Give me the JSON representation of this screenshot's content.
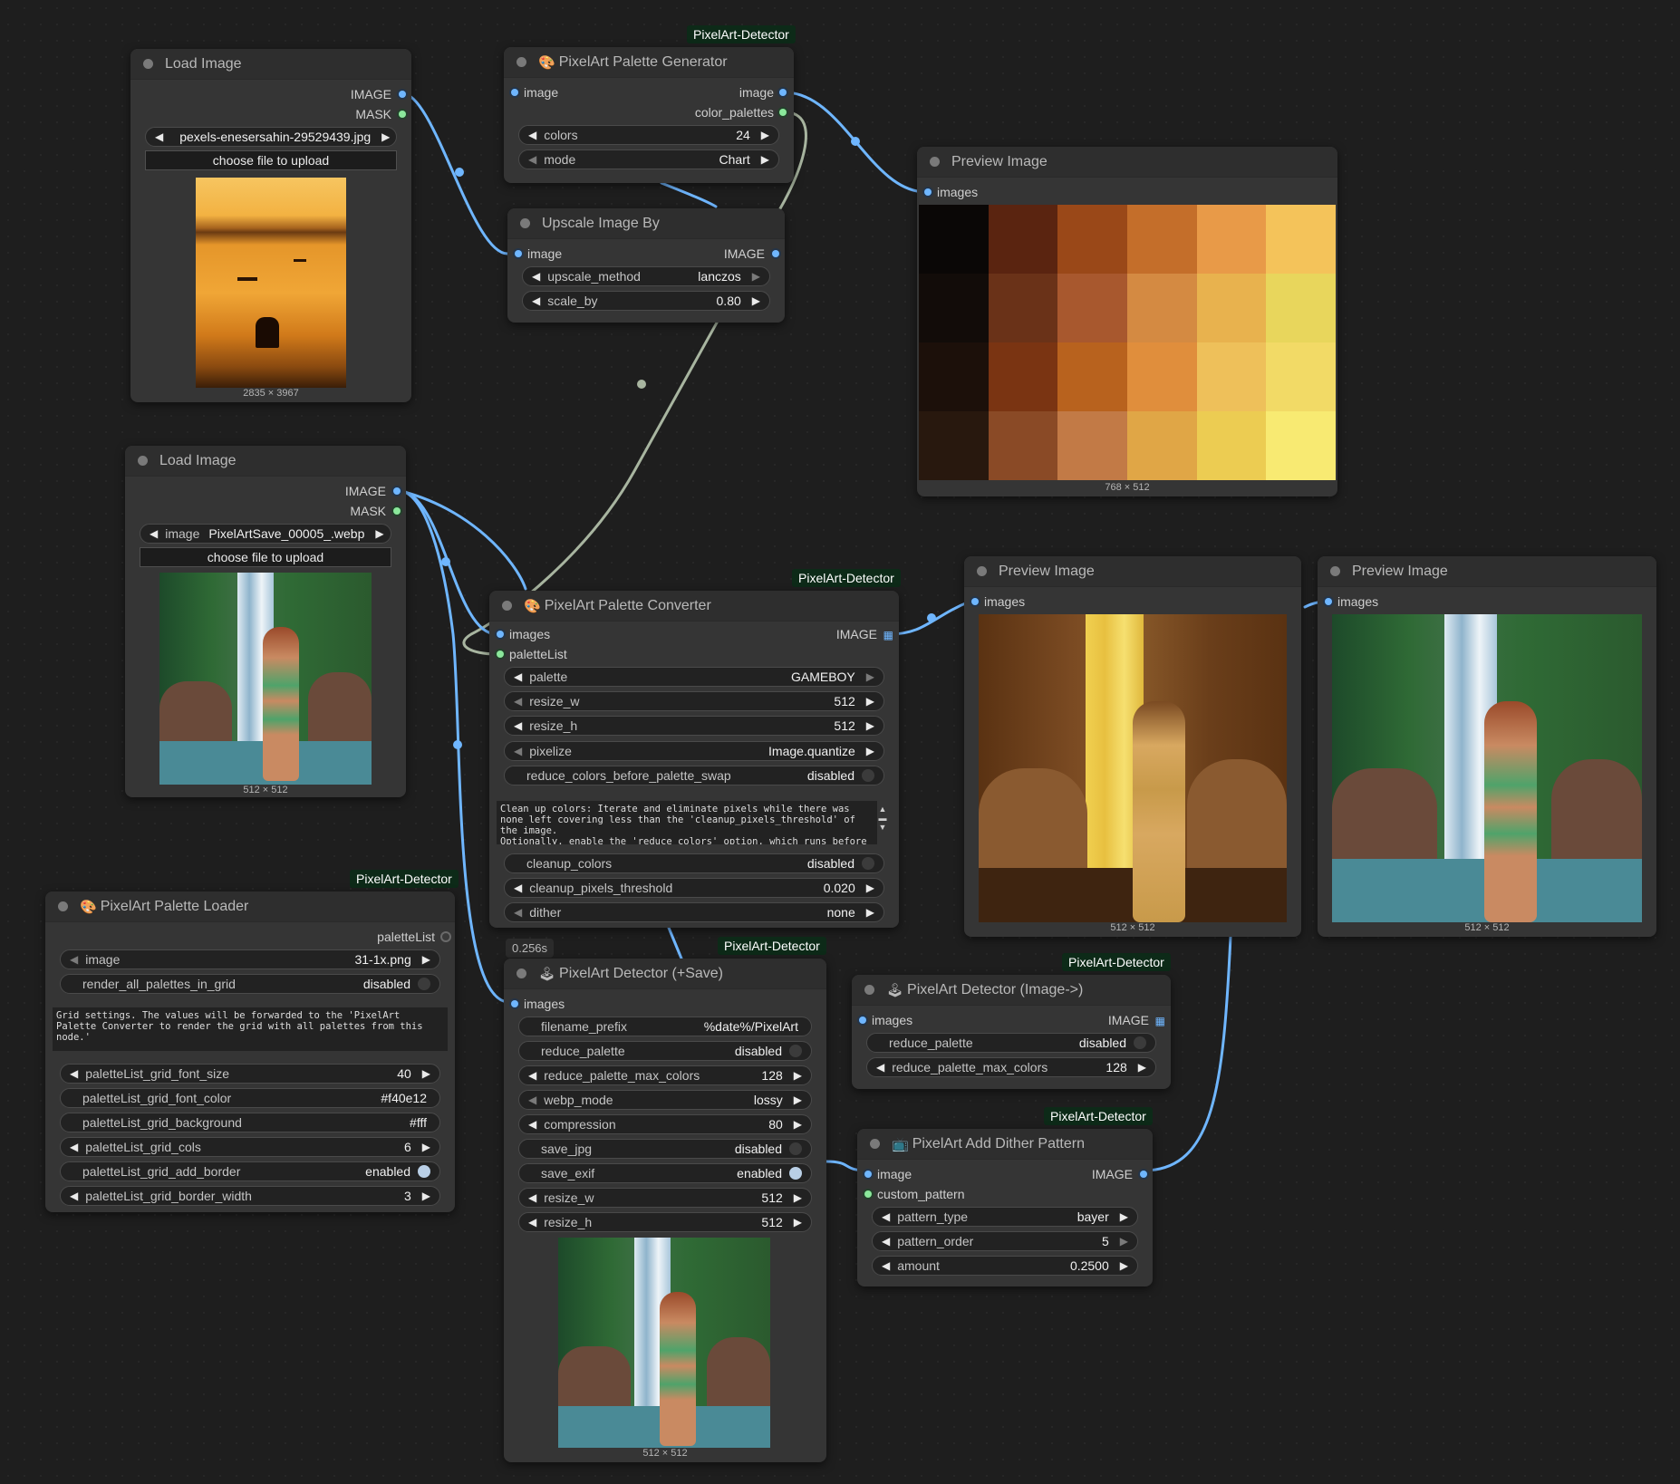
{
  "badge_label": "PixelArt-Detector",
  "nodes": {
    "load_image_1": {
      "title": "Load Image",
      "outputs": [
        "IMAGE",
        "MASK"
      ],
      "image_widget": {
        "label": "",
        "value": "pexels-enesersahin-29529439.jpg"
      },
      "upload_label": "choose file to upload",
      "dims": "2835 × 3967"
    },
    "palette_generator": {
      "title": "PixelArt Palette Generator",
      "input": "image",
      "outputs": [
        "image",
        "color_palettes"
      ],
      "widgets": [
        {
          "label": "colors",
          "value": "24"
        },
        {
          "label": "mode",
          "value": "Chart"
        }
      ]
    },
    "upscale": {
      "title": "Upscale Image By",
      "input": "image",
      "output": "IMAGE",
      "widgets": [
        {
          "label": "upscale_method",
          "value": "lanczos"
        },
        {
          "label": "scale_by",
          "value": "0.80"
        }
      ]
    },
    "preview_1": {
      "title": "Preview Image",
      "input": "images",
      "dims": "768 × 512"
    },
    "load_image_2": {
      "title": "Load Image",
      "outputs": [
        "IMAGE",
        "MASK"
      ],
      "image_widget": {
        "label": "image",
        "value": "PixelArtSave_00005_.webp"
      },
      "upload_label": "choose file to upload",
      "dims": "512 × 512"
    },
    "palette_converter": {
      "title": "PixelArt Palette Converter",
      "inputs": [
        "images",
        "paletteList"
      ],
      "output": "IMAGE",
      "widgets": [
        {
          "label": "palette",
          "value": "GAMEBOY"
        },
        {
          "label": "resize_w",
          "value": "512"
        },
        {
          "label": "resize_h",
          "value": "512"
        },
        {
          "label": "pixelize",
          "value": "Image.quantize"
        },
        {
          "label": "reduce_colors_before_palette_swap",
          "value": "disabled"
        }
      ],
      "note": "Clean up colors: Iterate and eliminate pixels while there was none left covering less than the 'cleanup_pixels_threshold' of the image.\nOptionally, enable the 'reduce colors' option, which runs before",
      "widgets2": [
        {
          "label": "cleanup_colors",
          "value": "disabled"
        },
        {
          "label": "cleanup_pixels_threshold",
          "value": "0.020"
        },
        {
          "label": "dither",
          "value": "none"
        }
      ]
    },
    "preview_2": {
      "title": "Preview Image",
      "input": "images",
      "dims": "512 × 512"
    },
    "preview_3": {
      "title": "Preview Image",
      "input": "images",
      "dims": "512 × 512"
    },
    "palette_loader": {
      "title": "PixelArt Palette Loader",
      "output": "paletteList",
      "widgets": [
        {
          "label": "image",
          "value": "31-1x.png"
        },
        {
          "label": "render_all_palettes_in_grid",
          "value": "disabled"
        }
      ],
      "note": "Grid settings. The values will be forwarded to the 'PixelArt Palette Converter to render the grid with all palettes from this node.'",
      "widgets2": [
        {
          "label": "paletteList_grid_font_size",
          "value": "40"
        },
        {
          "label": "paletteList_grid_font_color",
          "value": "#f40e12"
        },
        {
          "label": "paletteList_grid_background",
          "value": "#fff"
        },
        {
          "label": "paletteList_grid_cols",
          "value": "6"
        },
        {
          "label": "paletteList_grid_add_border",
          "value": "enabled"
        },
        {
          "label": "paletteList_grid_border_width",
          "value": "3"
        }
      ]
    },
    "detector_save": {
      "title": "PixelArt Detector (+Save)",
      "timer": "0.256s",
      "input": "images",
      "widgets": [
        {
          "label": "filename_prefix",
          "value": "%date%/PixelArt"
        },
        {
          "label": "reduce_palette",
          "value": "disabled"
        },
        {
          "label": "reduce_palette_max_colors",
          "value": "128"
        },
        {
          "label": "webp_mode",
          "value": "lossy"
        },
        {
          "label": "compression",
          "value": "80"
        },
        {
          "label": "save_jpg",
          "value": "disabled"
        },
        {
          "label": "save_exif",
          "value": "enabled"
        },
        {
          "label": "resize_w",
          "value": "512"
        },
        {
          "label": "resize_h",
          "value": "512"
        }
      ],
      "dims": "512 × 512"
    },
    "detector_image": {
      "title": "PixelArt Detector (Image->)",
      "input": "images",
      "output": "IMAGE",
      "widgets": [
        {
          "label": "reduce_palette",
          "value": "disabled"
        },
        {
          "label": "reduce_palette_max_colors",
          "value": "128"
        }
      ]
    },
    "dither": {
      "title": "PixelArt Add Dither Pattern",
      "inputs": [
        "image",
        "custom_pattern"
      ],
      "output": "IMAGE",
      "widgets": [
        {
          "label": "pattern_type",
          "value": "bayer"
        },
        {
          "label": "pattern_order",
          "value": "5"
        },
        {
          "label": "amount",
          "value": "0.2500"
        }
      ]
    }
  },
  "palette_colors": [
    "#0a0706",
    "#5a2410",
    "#9a4818",
    "#c46e2a",
    "#e89a48",
    "#f4c35a",
    "#120c09",
    "#6a3218",
    "#a8582e",
    "#d48a42",
    "#e8b24e",
    "#e8d65c",
    "#1c100a",
    "#7a3412",
    "#b8621e",
    "#e08e3c",
    "#eec05a",
    "#f2da66",
    "#28180e",
    "#8a4a26",
    "#c27a46",
    "#e0a646",
    "#eccc52",
    "#f8ea72"
  ],
  "colors": {
    "canvas": "#1e1e1e",
    "node_body": "#353535",
    "node_title": "#2e2e2e",
    "link_image": "#6fb6ff",
    "link_palette": "#a8b5a0",
    "badge_bg": "#0d2a18"
  }
}
